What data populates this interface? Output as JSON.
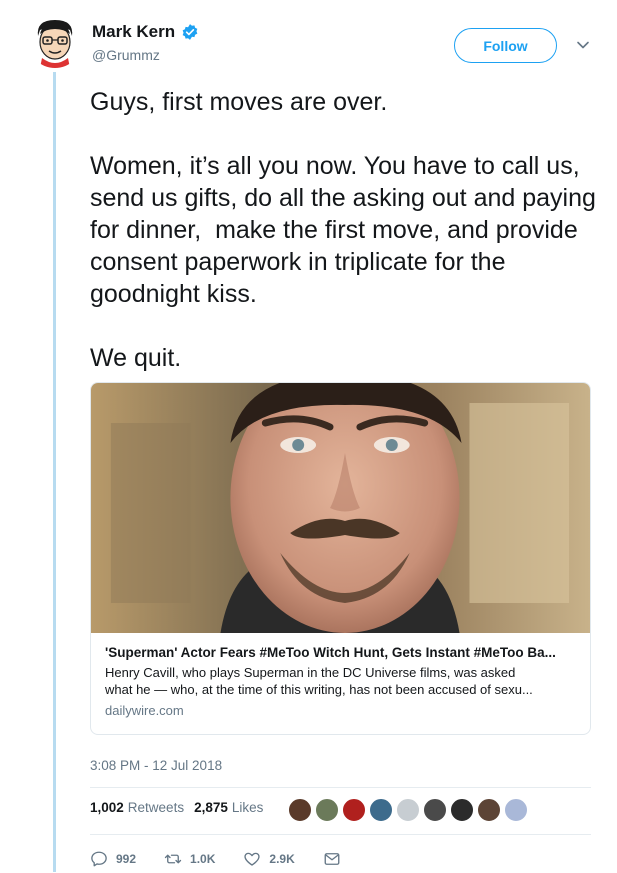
{
  "author": {
    "name": "Mark Kern",
    "handle": "@Grummz",
    "verified": true
  },
  "follow_label": "Follow",
  "tweet": {
    "paragraphs": [
      "Guys, first moves are over.",
      "Women, it’s all you now. You have to call us, send us gifts, do all the asking out and paying for dinner,  make the first move, and provide consent paperwork in triplicate for the goodnight kiss.",
      "We quit."
    ]
  },
  "card": {
    "title": "'Superman' Actor Fears #MeToo Witch Hunt, Gets Instant #MeToo Ba...",
    "desc_line1": "Henry Cavill, who plays Superman in the DC Universe films, was asked",
    "desc_line2": "what he — who, at the time of this writing, has not been accused of sexu...",
    "domain": "dailywire.com"
  },
  "timestamp": "3:08 PM - 12 Jul 2018",
  "stats": {
    "retweets_count": "1,002",
    "retweets_label": "Retweets",
    "likes_count": "2,875",
    "likes_label": "Likes"
  },
  "actions": {
    "replies": "992",
    "retweets": "1.0K",
    "likes": "2.9K"
  },
  "colors": {
    "accent": "#1da1f2",
    "muted": "#657786",
    "thread_line": "#b7dbf0"
  }
}
